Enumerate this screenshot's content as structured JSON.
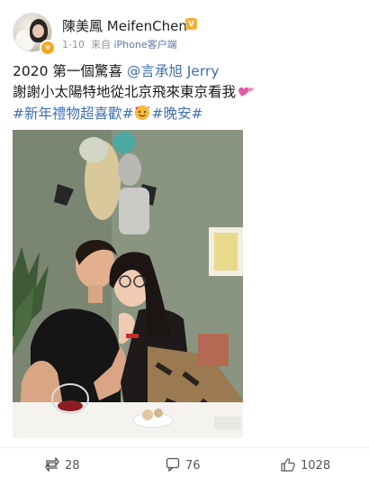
{
  "post": {
    "author_name": "陳美鳳 MeifenChen",
    "timestamp": "1-10",
    "source_prefix": "来自",
    "source": "iPhone客户端",
    "line1_text": "2020 第一個驚喜 ",
    "mention": "@言承旭 Jerry",
    "line2_text": "謝謝小太陽特地從北京飛來東京看我",
    "hashtag1": "#新年禮物超喜歡#",
    "hashtag2": "#晚安#",
    "emoji_heart": "two-hearts-emoji",
    "emoji_face": "smiling-face-with-hearts-emoji"
  },
  "actions": {
    "repost_count": "28",
    "comment_count": "76",
    "like_count": "1028"
  },
  "colors": {
    "link": "#3f6fb4",
    "meta": "#939393",
    "verified": "#f5a623"
  }
}
